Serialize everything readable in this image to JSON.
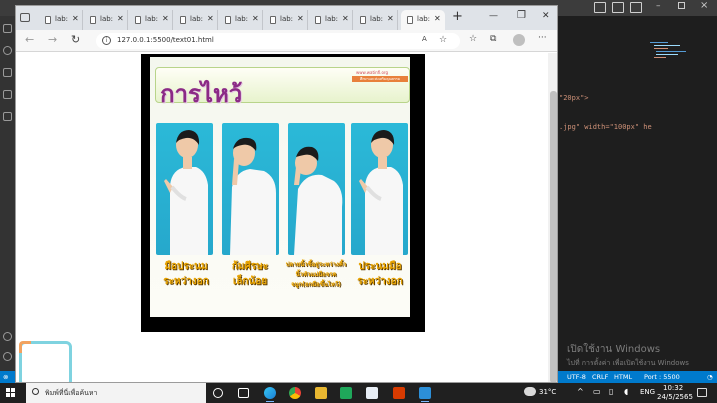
{
  "browser": {
    "tabs": [
      {
        "label": "lab:"
      },
      {
        "label": "lab:"
      },
      {
        "label": "lab:"
      },
      {
        "label": "lab:"
      },
      {
        "label": "lab:"
      },
      {
        "label": "lab:"
      },
      {
        "label": "lab:"
      },
      {
        "label": "lab:"
      },
      {
        "label": "lab:",
        "active": true
      }
    ],
    "url": "127.0.0.1:5500/text01.html",
    "page": {
      "poster_title": "การไหว้",
      "poster_credit": "www.watinfl.org",
      "poster_badge": "ศึกษาและส่งเสริมคุณธรรม",
      "captions": [
        {
          "line1": "มือประนม",
          "line2": "ระหว่างอก"
        },
        {
          "line1": "ก้มศีรษะ",
          "line2": "เล็กน้อย"
        },
        {
          "line1": "ปลายนิ้วชี้อยู่ระหว่างคิ้ว",
          "line2": "นิ้วหัวแม่มือจรด",
          "line3": "จมูก(ยกมือขึ้นไหว้)"
        },
        {
          "line1": "ประนมมือ",
          "line2": "ระหว่างอก"
        }
      ]
    }
  },
  "vscode": {
    "code_snippets": {
      "line1": "\"20px\">",
      "line2": ".jpg\" width=\"100px\" he"
    },
    "status_bar": {
      "encoding": "UTF-8",
      "eol": "CRLF",
      "language": "HTML",
      "port": "Port : 5500"
    },
    "activation": {
      "line1": "เปิดใช้งาน Windows",
      "line2": "ไปที่ การตั้งค่า เพื่อเปิดใช้งาน Windows"
    }
  },
  "taskbar": {
    "search_placeholder": "พิมพ์ที่นี่เพื่อค้นหา",
    "weather": "31°C",
    "language": "ENG",
    "time": "10:32",
    "date": "24/5/2565"
  },
  "colors": {
    "title_purple": "#8b2a86",
    "panel_blue": "#2bb9d8",
    "caption_gold": "#e8a300",
    "vscode_status": "#007acc",
    "taskbar": "#202020"
  }
}
